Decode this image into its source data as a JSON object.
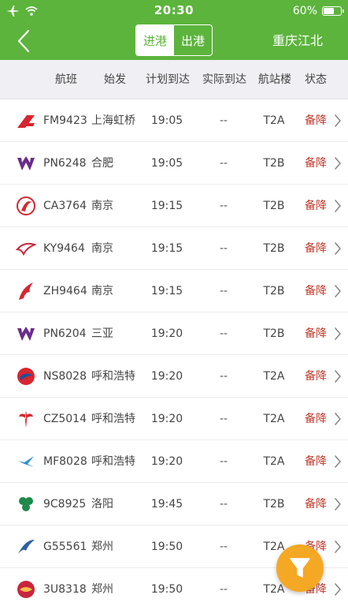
{
  "status_bar": {
    "time": "20:30",
    "battery": "60%",
    "battery_level": 0.6
  },
  "nav": {
    "back_icon": "chevron-left-icon",
    "tabs": [
      {
        "label": "进港",
        "active": true
      },
      {
        "label": "出港",
        "active": false
      }
    ],
    "airport": "重庆江北"
  },
  "columns": [
    "航班",
    "始发",
    "计划到达",
    "实际到达",
    "航站楼",
    "状态"
  ],
  "flights": [
    {
      "logo": "shanghai-airlines-logo",
      "flight": "FM9423",
      "origin": "上海虹桥",
      "planned": "19:05",
      "actual": "--",
      "terminal": "T2A",
      "status": "备降"
    },
    {
      "logo": "west-air-logo",
      "flight": "PN6248",
      "origin": "合肥",
      "planned": "19:05",
      "actual": "--",
      "terminal": "T2B",
      "status": "备降"
    },
    {
      "logo": "air-china-logo",
      "flight": "CA3764",
      "origin": "南京",
      "planned": "19:15",
      "actual": "--",
      "terminal": "T2B",
      "status": "备降"
    },
    {
      "logo": "kunming-airlines-logo",
      "flight": "KY9464",
      "origin": "南京",
      "planned": "19:15",
      "actual": "--",
      "terminal": "T2B",
      "status": "备降"
    },
    {
      "logo": "shenzhen-airlines-logo",
      "flight": "ZH9464",
      "origin": "南京",
      "planned": "19:15",
      "actual": "--",
      "terminal": "T2B",
      "status": "备降"
    },
    {
      "logo": "west-air-logo",
      "flight": "PN6204",
      "origin": "三亚",
      "planned": "19:20",
      "actual": "--",
      "terminal": "T2B",
      "status": "备降"
    },
    {
      "logo": "china-eastern-logo",
      "flight": "NS8028",
      "origin": "呼和浩特",
      "planned": "19:20",
      "actual": "--",
      "terminal": "T2A",
      "status": "备降"
    },
    {
      "logo": "china-southern-logo",
      "flight": "CZ5014",
      "origin": "呼和浩特",
      "planned": "19:20",
      "actual": "--",
      "terminal": "T2A",
      "status": "备降"
    },
    {
      "logo": "xiamen-airlines-logo",
      "flight": "MF8028",
      "origin": "呼和浩特",
      "planned": "19:20",
      "actual": "--",
      "terminal": "T2A",
      "status": "备降"
    },
    {
      "logo": "spring-airlines-logo",
      "flight": "9C8925",
      "origin": "洛阳",
      "planned": "19:45",
      "actual": "--",
      "terminal": "T2B",
      "status": "备降"
    },
    {
      "logo": "juneyao-airlines-logo",
      "flight": "G55561",
      "origin": "郑州",
      "planned": "19:50",
      "actual": "--",
      "terminal": "T2A",
      "status": "备降"
    },
    {
      "logo": "sichuan-airlines-logo",
      "flight": "3U8318",
      "origin": "郑州",
      "planned": "19:50",
      "actual": "--",
      "terminal": "T2A",
      "status": "备降"
    }
  ],
  "filter_icon": "filter-icon",
  "colors": {
    "brand_green": "#5cb43c",
    "status_red": "#c0392b",
    "fab_orange": "#f5a823"
  }
}
